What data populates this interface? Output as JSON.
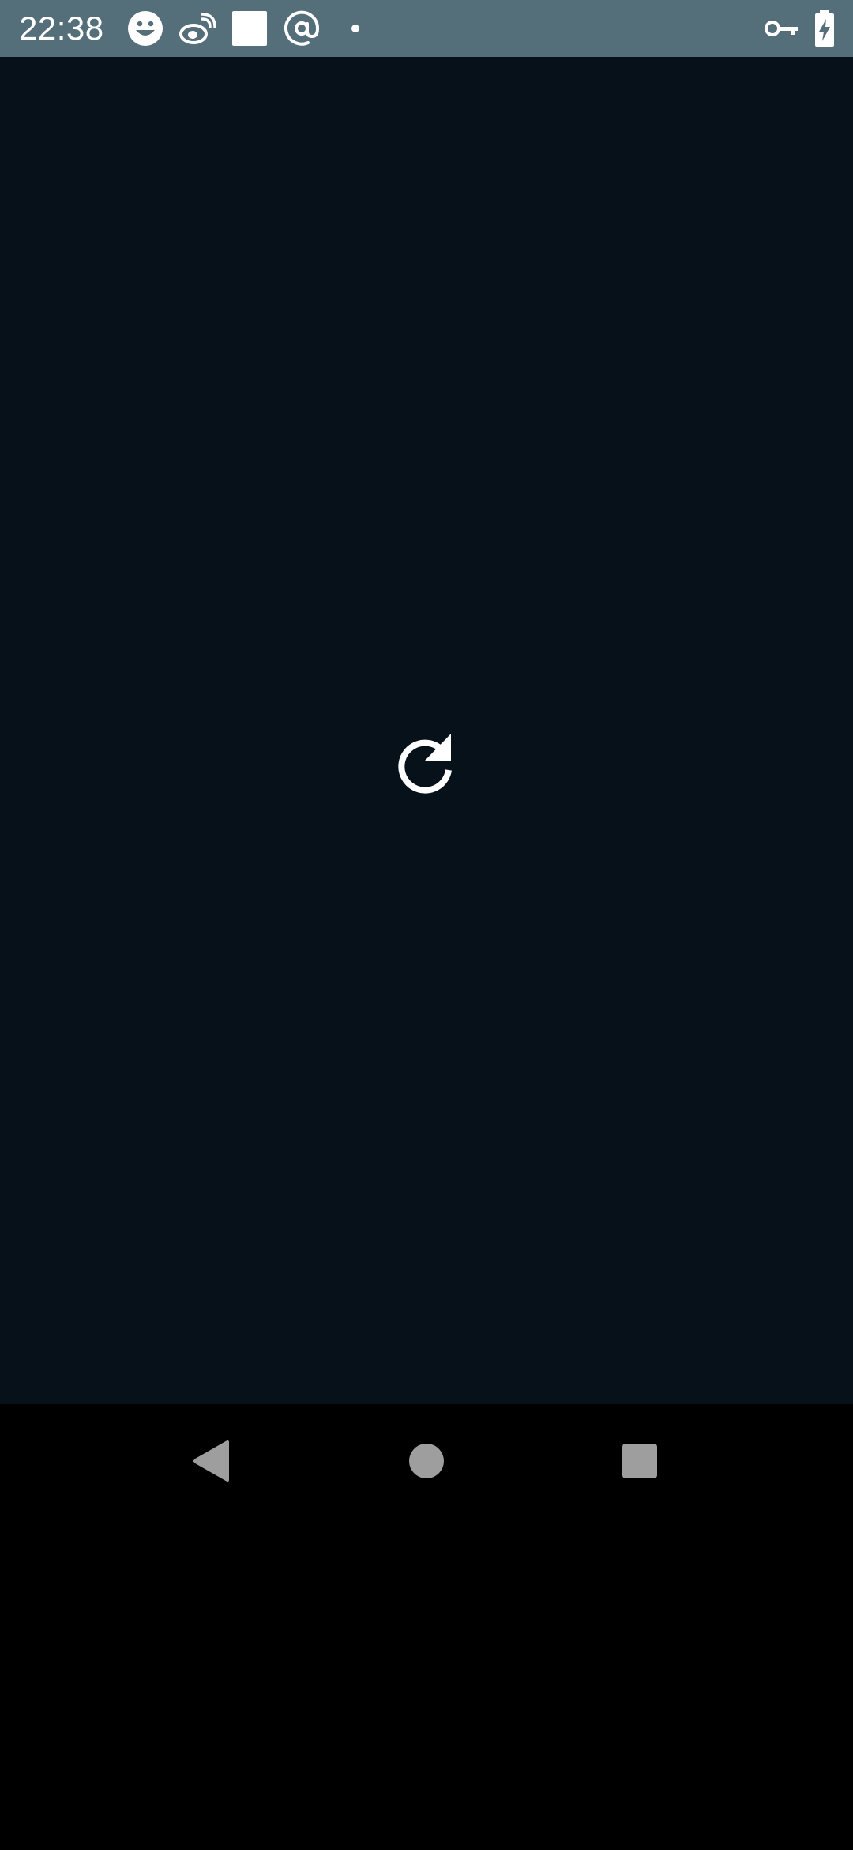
{
  "status_bar": {
    "time": "22:38",
    "background": "#546e7a",
    "left_icons": [
      "smiley-icon",
      "weibo-icon",
      "square-notification-icon",
      "at-sign-icon",
      "dot-icon"
    ],
    "right_icons": [
      "vpn-key-icon",
      "battery-charging-icon"
    ]
  },
  "content": {
    "background": "#06111a",
    "center_icon": "reload-icon"
  },
  "nav_bar": {
    "buttons": [
      "back-button",
      "home-button",
      "recents-button"
    ],
    "button_color": "#9e9e9e"
  }
}
